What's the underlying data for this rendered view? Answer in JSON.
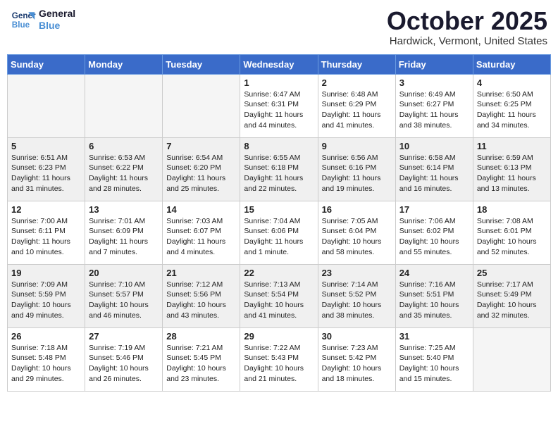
{
  "header": {
    "logo_line1": "General",
    "logo_line2": "Blue",
    "month": "October 2025",
    "location": "Hardwick, Vermont, United States"
  },
  "days_of_week": [
    "Sunday",
    "Monday",
    "Tuesday",
    "Wednesday",
    "Thursday",
    "Friday",
    "Saturday"
  ],
  "weeks": [
    [
      {
        "day": "",
        "empty": true
      },
      {
        "day": "",
        "empty": true
      },
      {
        "day": "",
        "empty": true
      },
      {
        "day": "1",
        "sunrise": "6:47 AM",
        "sunset": "6:31 PM",
        "daylight": "11 hours and 44 minutes."
      },
      {
        "day": "2",
        "sunrise": "6:48 AM",
        "sunset": "6:29 PM",
        "daylight": "11 hours and 41 minutes."
      },
      {
        "day": "3",
        "sunrise": "6:49 AM",
        "sunset": "6:27 PM",
        "daylight": "11 hours and 38 minutes."
      },
      {
        "day": "4",
        "sunrise": "6:50 AM",
        "sunset": "6:25 PM",
        "daylight": "11 hours and 34 minutes."
      }
    ],
    [
      {
        "day": "5",
        "sunrise": "6:51 AM",
        "sunset": "6:23 PM",
        "daylight": "11 hours and 31 minutes."
      },
      {
        "day": "6",
        "sunrise": "6:53 AM",
        "sunset": "6:22 PM",
        "daylight": "11 hours and 28 minutes."
      },
      {
        "day": "7",
        "sunrise": "6:54 AM",
        "sunset": "6:20 PM",
        "daylight": "11 hours and 25 minutes."
      },
      {
        "day": "8",
        "sunrise": "6:55 AM",
        "sunset": "6:18 PM",
        "daylight": "11 hours and 22 minutes."
      },
      {
        "day": "9",
        "sunrise": "6:56 AM",
        "sunset": "6:16 PM",
        "daylight": "11 hours and 19 minutes."
      },
      {
        "day": "10",
        "sunrise": "6:58 AM",
        "sunset": "6:14 PM",
        "daylight": "11 hours and 16 minutes."
      },
      {
        "day": "11",
        "sunrise": "6:59 AM",
        "sunset": "6:13 PM",
        "daylight": "11 hours and 13 minutes."
      }
    ],
    [
      {
        "day": "12",
        "sunrise": "7:00 AM",
        "sunset": "6:11 PM",
        "daylight": "11 hours and 10 minutes."
      },
      {
        "day": "13",
        "sunrise": "7:01 AM",
        "sunset": "6:09 PM",
        "daylight": "11 hours and 7 minutes."
      },
      {
        "day": "14",
        "sunrise": "7:03 AM",
        "sunset": "6:07 PM",
        "daylight": "11 hours and 4 minutes."
      },
      {
        "day": "15",
        "sunrise": "7:04 AM",
        "sunset": "6:06 PM",
        "daylight": "11 hours and 1 minute."
      },
      {
        "day": "16",
        "sunrise": "7:05 AM",
        "sunset": "6:04 PM",
        "daylight": "10 hours and 58 minutes."
      },
      {
        "day": "17",
        "sunrise": "7:06 AM",
        "sunset": "6:02 PM",
        "daylight": "10 hours and 55 minutes."
      },
      {
        "day": "18",
        "sunrise": "7:08 AM",
        "sunset": "6:01 PM",
        "daylight": "10 hours and 52 minutes."
      }
    ],
    [
      {
        "day": "19",
        "sunrise": "7:09 AM",
        "sunset": "5:59 PM",
        "daylight": "10 hours and 49 minutes."
      },
      {
        "day": "20",
        "sunrise": "7:10 AM",
        "sunset": "5:57 PM",
        "daylight": "10 hours and 46 minutes."
      },
      {
        "day": "21",
        "sunrise": "7:12 AM",
        "sunset": "5:56 PM",
        "daylight": "10 hours and 43 minutes."
      },
      {
        "day": "22",
        "sunrise": "7:13 AM",
        "sunset": "5:54 PM",
        "daylight": "10 hours and 41 minutes."
      },
      {
        "day": "23",
        "sunrise": "7:14 AM",
        "sunset": "5:52 PM",
        "daylight": "10 hours and 38 minutes."
      },
      {
        "day": "24",
        "sunrise": "7:16 AM",
        "sunset": "5:51 PM",
        "daylight": "10 hours and 35 minutes."
      },
      {
        "day": "25",
        "sunrise": "7:17 AM",
        "sunset": "5:49 PM",
        "daylight": "10 hours and 32 minutes."
      }
    ],
    [
      {
        "day": "26",
        "sunrise": "7:18 AM",
        "sunset": "5:48 PM",
        "daylight": "10 hours and 29 minutes."
      },
      {
        "day": "27",
        "sunrise": "7:19 AM",
        "sunset": "5:46 PM",
        "daylight": "10 hours and 26 minutes."
      },
      {
        "day": "28",
        "sunrise": "7:21 AM",
        "sunset": "5:45 PM",
        "daylight": "10 hours and 23 minutes."
      },
      {
        "day": "29",
        "sunrise": "7:22 AM",
        "sunset": "5:43 PM",
        "daylight": "10 hours and 21 minutes."
      },
      {
        "day": "30",
        "sunrise": "7:23 AM",
        "sunset": "5:42 PM",
        "daylight": "10 hours and 18 minutes."
      },
      {
        "day": "31",
        "sunrise": "7:25 AM",
        "sunset": "5:40 PM",
        "daylight": "10 hours and 15 minutes."
      },
      {
        "day": "",
        "empty": true
      }
    ]
  ],
  "row_shading": [
    false,
    true,
    false,
    true,
    false
  ]
}
